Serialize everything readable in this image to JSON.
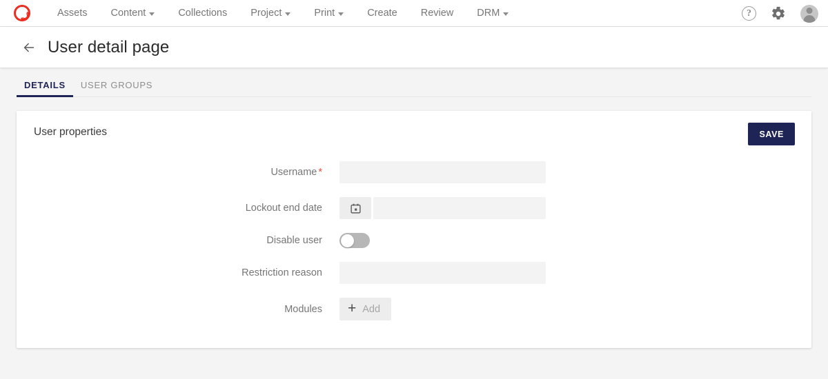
{
  "topnav": {
    "logo_name": "app-logo",
    "brand_color": "#ee2d1f",
    "items": [
      {
        "label": "Assets",
        "has_caret": false
      },
      {
        "label": "Content",
        "has_caret": true
      },
      {
        "label": "Collections",
        "has_caret": false
      },
      {
        "label": "Project",
        "has_caret": true
      },
      {
        "label": "Print",
        "has_caret": true
      },
      {
        "label": "Create",
        "has_caret": false
      },
      {
        "label": "Review",
        "has_caret": false
      },
      {
        "label": "DRM",
        "has_caret": true
      }
    ],
    "right_icons": [
      {
        "name": "help-icon",
        "glyph": "?"
      },
      {
        "name": "gear-icon",
        "glyph": ""
      },
      {
        "name": "avatar",
        "glyph": ""
      }
    ]
  },
  "titlebar": {
    "back_icon": "back-arrow-icon",
    "title": "User detail page"
  },
  "tabs": [
    {
      "label": "DETAILS",
      "active": true
    },
    {
      "label": "USER GROUPS",
      "active": false
    }
  ],
  "card": {
    "title": "User properties",
    "save_label": "SAVE",
    "save_color": "#1f2457"
  },
  "form": {
    "fields": [
      {
        "label": "Username",
        "required": true,
        "required_marker": "*",
        "type": "text",
        "value": "",
        "placeholder": ""
      },
      {
        "label": "Lockout end date",
        "required": false,
        "type": "date",
        "value": "",
        "placeholder": "",
        "icon": "calendar-icon"
      },
      {
        "label": "Disable user",
        "required": false,
        "type": "toggle",
        "value": "off"
      },
      {
        "label": "Restriction reason",
        "required": false,
        "type": "text",
        "value": "",
        "placeholder": ""
      },
      {
        "label": "Modules",
        "required": false,
        "type": "add-button",
        "add_label": "Add",
        "add_icon": "plus-icon"
      }
    ]
  }
}
